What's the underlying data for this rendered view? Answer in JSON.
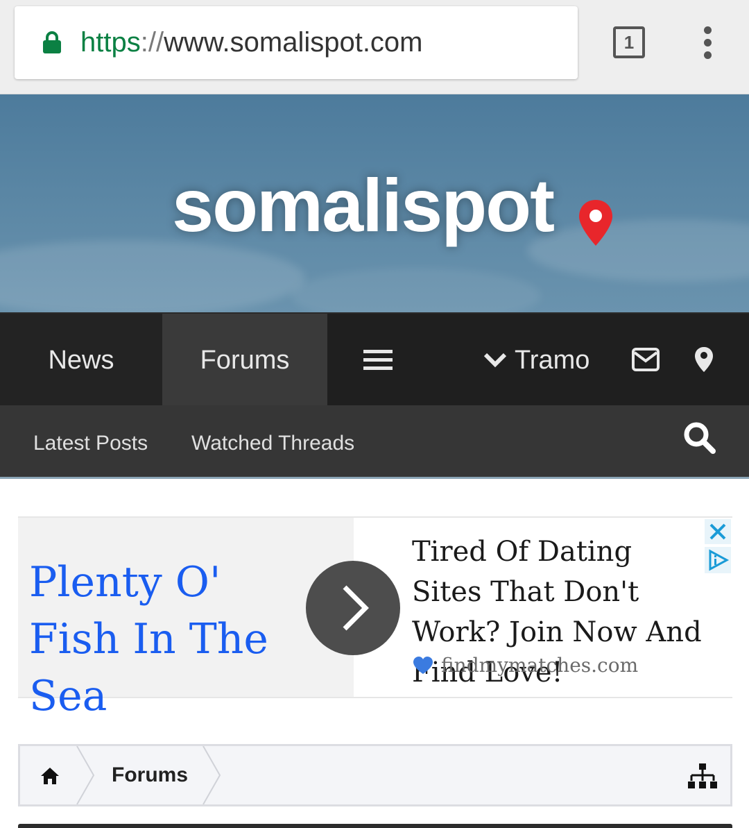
{
  "browser": {
    "url_scheme": "https",
    "url_separator": "://",
    "url_host": "www.somalispot.com",
    "tab_count": "1",
    "lock_icon": "lock-icon",
    "menu_icon": "overflow-menu-icon",
    "colors": {
      "scheme": "#0b8043",
      "host": "#333333"
    }
  },
  "banner": {
    "logo_text": "somalispot",
    "pin_icon": "map-pin-icon",
    "pin_color": "#e8262b"
  },
  "main_nav": {
    "items": [
      {
        "label": "News"
      },
      {
        "label": "Forums",
        "active": true
      }
    ],
    "menu_icon": "hamburger-icon",
    "user_label": "Tramo",
    "user_icon": "chevron-down-icon",
    "inbox_icon": "envelope-icon",
    "alerts_icon": "map-marker-icon"
  },
  "sub_nav": {
    "items": [
      {
        "label": "Latest Posts"
      },
      {
        "label": "Watched Threads"
      }
    ],
    "search_icon": "search-icon"
  },
  "ad": {
    "headline": "Plenty O' Fish In The Sea",
    "body": "Tired Of Dating Sites That Don't Work? Join Now And Find Love!",
    "domain": "findmymatches.com",
    "arrow_icon": "chevron-right-icon",
    "heart_icon": "heart-icon",
    "close_icon": "close-icon",
    "adchoices_icon": "adchoices-icon",
    "colors": {
      "headline": "#1a5df0",
      "arrow_bg": "#4d4d4d"
    }
  },
  "breadcrumb": {
    "home_icon": "home-icon",
    "current": "Forums",
    "sitemap_icon": "sitemap-icon"
  }
}
